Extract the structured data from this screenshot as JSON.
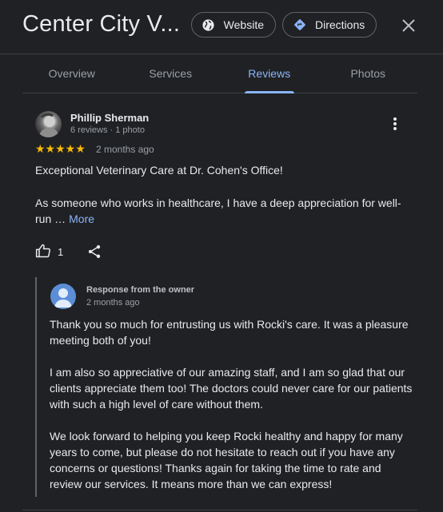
{
  "header": {
    "title": "Center City V...",
    "website_label": "Website",
    "directions_label": "Directions"
  },
  "tabs": [
    {
      "label": "Overview",
      "active": false
    },
    {
      "label": "Services",
      "active": false
    },
    {
      "label": "Reviews",
      "active": true
    },
    {
      "label": "Photos",
      "active": false
    }
  ],
  "review": {
    "reviewer_name": "Phillip Sherman",
    "reviewer_meta": "6 reviews · 1 photo",
    "stars": "★★★★★",
    "rating": 5,
    "date": "2 months ago",
    "title": "Exceptional Veterinary Care at Dr. Cohen's Office!",
    "body": "As someone who works in healthcare, I have a deep appreciation for well-run …",
    "more_label": "More",
    "like_count": "1"
  },
  "owner_response": {
    "label": "Response from the owner",
    "date": "2 months ago",
    "paragraphs": [
      "Thank you so much for entrusting us with Rocki's care. It was a pleasure meeting both of you!",
      "I am also so appreciative of our amazing staff, and I am so glad that our clients appreciate them too! The doctors could never care for our patients with such a high level of care without them.",
      "We look forward to helping you keep Rocki healthy and happy for many years to come, but please do not hesitate to reach out if you have any concerns or questions! Thanks again for taking the time to rate and review our services. It means more than we can express!"
    ]
  },
  "colors": {
    "background": "#202124",
    "accent": "#8ab4f8",
    "star": "#fbbc04",
    "owner_avatar": "#5b8ed6"
  },
  "icons": [
    "globe-icon",
    "directions-icon",
    "close-icon",
    "more-vert-icon",
    "thumb-up-icon",
    "share-icon",
    "person-icon"
  ]
}
